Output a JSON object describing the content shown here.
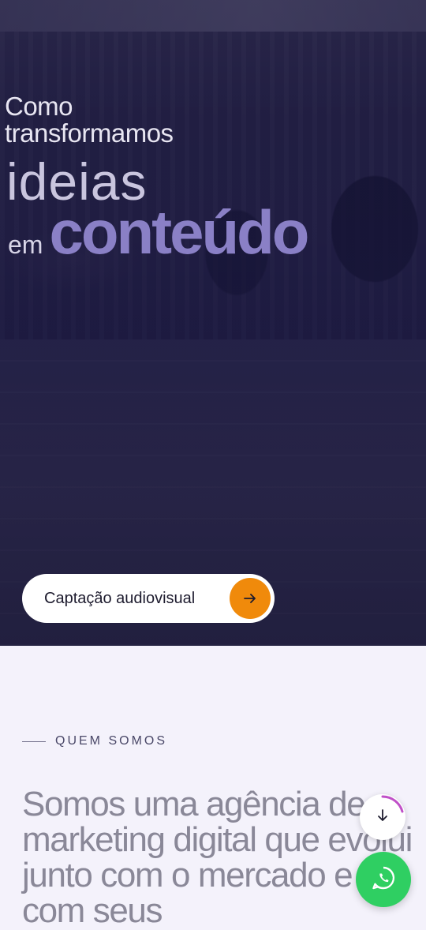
{
  "hero": {
    "line1": "Como",
    "line2": "transformamos",
    "line3": "ideias",
    "line4_prefix": "em",
    "line4_highlight": "conteúdo",
    "service_button": {
      "label": "Captação audiovisual",
      "icon": "arrow-right-icon"
    },
    "highlight_color": "#8a80c6",
    "accent_color": "#f08a0b"
  },
  "about": {
    "section_label": "QUEM SOMOS",
    "heading": "Somos uma agência de marketing digital que evolui junto com o mercado e com seus"
  },
  "floating": {
    "scroll_icon": "arrow-down-icon",
    "whatsapp_icon": "whatsapp-icon",
    "whatsapp_color": "#2fcf62"
  }
}
